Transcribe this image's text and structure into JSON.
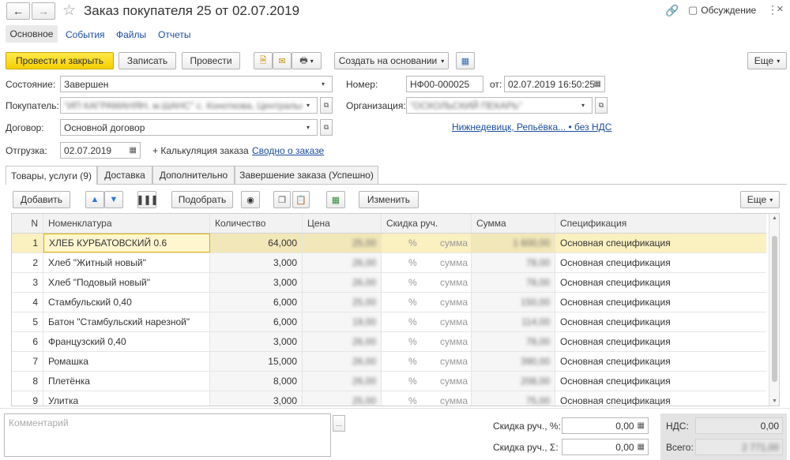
{
  "header": {
    "title": "Заказ покупателя 25 от 02.07.2019",
    "discussion": "Обсуждение"
  },
  "nav_tabs": [
    "Основное",
    "События",
    "Файлы",
    "Отчеты"
  ],
  "toolbar": {
    "post_close": "Провести и закрыть",
    "save": "Записать",
    "post": "Провести",
    "create_based": "Создать на основании",
    "more": "Еще"
  },
  "form": {
    "state_label": "Состояние:",
    "state_value": "Завершен",
    "number_label": "Номер:",
    "number_value": "НФ00-000025",
    "from_label": "от:",
    "date_value": "02.07.2019 16:50:25",
    "buyer_label": "Покупатель:",
    "buyer_value": "\"ИП КАГРАМАНЯН, м.ШАНС\" с. Коноткова, Центральная,",
    "org_label": "Организация:",
    "org_value": "\"ОСКОЛЬСКИЙ ПЕКАРЬ\"",
    "contract_label": "Договор:",
    "contract_value": "Основной договор",
    "delivery_link": "Нижнедевицк, Репьёвка... • без НДС",
    "shipment_label": "Отгрузка:",
    "shipment_value": "02.07.2019",
    "calc_label": "+ Калькуляция заказа",
    "summary_link": "Сводно о заказе"
  },
  "tabs": [
    "Товары, услуги (9)",
    "Доставка",
    "Дополнительно",
    "Завершение заказа (Успешно)"
  ],
  "table_toolbar": {
    "add": "Добавить",
    "pick": "Подобрать",
    "change": "Изменить",
    "more": "Еще"
  },
  "table": {
    "columns": [
      "N",
      "Номенклатура",
      "Количество",
      "Цена",
      "Скидка руч.",
      "Сумма",
      "Спецификация"
    ],
    "rows": [
      {
        "n": "1",
        "name": "ХЛЕБ КУРБАТОВСКИЙ 0.6",
        "qty": "64,000",
        "price": "25,00",
        "pct": "%",
        "sum_lbl": "сумма",
        "sum": "1 600,00",
        "spec": "Основная спецификация"
      },
      {
        "n": "2",
        "name": "Хлеб \"Житный новый\"",
        "qty": "3,000",
        "price": "26,00",
        "pct": "%",
        "sum_lbl": "сумма",
        "sum": "78,00",
        "spec": "Основная спецификация"
      },
      {
        "n": "3",
        "name": "Хлеб \"Подовый новый\"",
        "qty": "3,000",
        "price": "26,00",
        "pct": "%",
        "sum_lbl": "сумма",
        "sum": "78,00",
        "spec": "Основная спецификация"
      },
      {
        "n": "4",
        "name": "Стамбульский 0,40",
        "qty": "6,000",
        "price": "25,00",
        "pct": "%",
        "sum_lbl": "сумма",
        "sum": "150,00",
        "spec": "Основная спецификация"
      },
      {
        "n": "5",
        "name": "Батон \"Стамбульский нарезной\"",
        "qty": "6,000",
        "price": "19,00",
        "pct": "%",
        "sum_lbl": "сумма",
        "sum": "114,00",
        "spec": "Основная спецификация"
      },
      {
        "n": "6",
        "name": "Французский 0,40",
        "qty": "3,000",
        "price": "26,00",
        "pct": "%",
        "sum_lbl": "сумма",
        "sum": "78,00",
        "spec": "Основная спецификация"
      },
      {
        "n": "7",
        "name": "Ромашка",
        "qty": "15,000",
        "price": "26,00",
        "pct": "%",
        "sum_lbl": "сумма",
        "sum": "390,00",
        "spec": "Основная спецификация"
      },
      {
        "n": "8",
        "name": "Плетёнка",
        "qty": "8,000",
        "price": "26,00",
        "pct": "%",
        "sum_lbl": "сумма",
        "sum": "208,00",
        "spec": "Основная спецификация"
      },
      {
        "n": "9",
        "name": "Улитка",
        "qty": "3,000",
        "price": "25,00",
        "pct": "%",
        "sum_lbl": "сумма",
        "sum": "75,00",
        "spec": "Основная спецификация"
      }
    ]
  },
  "footer": {
    "comment_placeholder": "Комментарий",
    "disc_pct_label": "Скидка руч., %:",
    "disc_pct_value": "0,00",
    "disc_sum_label": "Скидка руч., Σ:",
    "disc_sum_value": "0,00",
    "vat_label": "НДС:",
    "vat_value": "0,00",
    "total_label": "Всего:",
    "total_value": "2 771,00"
  }
}
